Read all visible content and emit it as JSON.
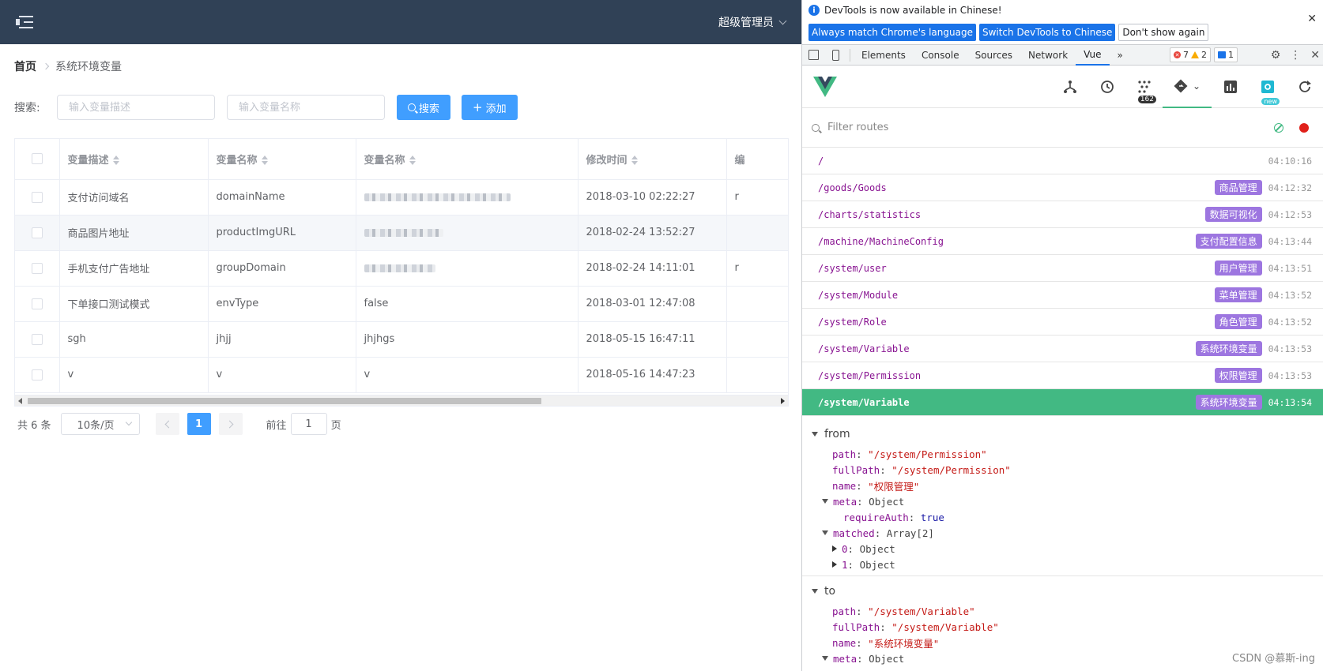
{
  "app": {
    "user_name": "超级管理员",
    "breadcrumb": {
      "home": "首页",
      "current": "系统环境变量"
    },
    "search": {
      "label": "搜索:",
      "desc_placeholder": "输入变量描述",
      "name_placeholder": "输入变量名称",
      "search_btn": "搜索",
      "add_btn": "添加"
    },
    "table": {
      "headers": [
        "变量描述",
        "变量名称",
        "变量名称",
        "修改时间"
      ],
      "rows": [
        {
          "desc": "支付访问域名",
          "name": "domainName",
          "value": "",
          "time": "2018-03-10 02:22:27",
          "more": "r"
        },
        {
          "desc": "商品图片地址",
          "name": "productImgURL",
          "value": "",
          "time": "2018-02-24 13:52:27",
          "more": ""
        },
        {
          "desc": "手机支付广告地址",
          "name": "groupDomain",
          "value": "",
          "time": "2018-02-24 14:11:01",
          "more": "r"
        },
        {
          "desc": "下单接口测试模式",
          "name": "envType",
          "value": "false",
          "time": "2018-03-01 12:47:08",
          "more": ""
        },
        {
          "desc": "sgh",
          "name": "jhjj",
          "value": "jhjhgs",
          "time": "2018-05-15 16:47:11",
          "more": ""
        },
        {
          "desc": "v",
          "name": "v",
          "value": "v",
          "time": "2018-05-16 14:47:23",
          "more": ""
        }
      ]
    },
    "pager": {
      "total": "共 6 条",
      "page_size": "10条/页",
      "current": "1",
      "goto_label": "前往",
      "goto_value": "1",
      "page_suffix": "页"
    }
  },
  "devtools": {
    "info_message": "DevTools is now available in Chinese!",
    "btn_match": "Always match Chrome's language",
    "btn_switch": "Switch DevTools to Chinese",
    "btn_dismiss": "Don't show again",
    "tabs": [
      "Elements",
      "Console",
      "Sources",
      "Network",
      "Vue"
    ],
    "errors": "7",
    "warnings": "2",
    "messages": "1",
    "component_count": "162",
    "new_badge": "new",
    "filter_placeholder": "Filter routes",
    "routes": [
      {
        "path": "/",
        "tag": "",
        "time": "04:10:16"
      },
      {
        "path": "/goods/Goods",
        "tag": "商品管理",
        "time": "04:12:32"
      },
      {
        "path": "/charts/statistics",
        "tag": "数据可视化",
        "time": "04:12:53"
      },
      {
        "path": "/machine/MachineConfig",
        "tag": "支付配置信息",
        "time": "04:13:44"
      },
      {
        "path": "/system/user",
        "tag": "用户管理",
        "time": "04:13:51"
      },
      {
        "path": "/system/Module",
        "tag": "菜单管理",
        "time": "04:13:52"
      },
      {
        "path": "/system/Role",
        "tag": "角色管理",
        "time": "04:13:52"
      },
      {
        "path": "/system/Variable",
        "tag": "系统环境变量",
        "time": "04:13:53"
      },
      {
        "path": "/system/Permission",
        "tag": "权限管理",
        "time": "04:13:53"
      },
      {
        "path": "/system/Variable",
        "tag": "系统环境变量",
        "time": "04:13:54"
      }
    ],
    "from": {
      "title": "from",
      "path": "\"/system/Permission\"",
      "fullPath": "\"/system/Permission\"",
      "name": "\"权限管理\"",
      "meta": "Object",
      "requireAuth": "true",
      "matched": "Array[2]",
      "m0": "Object",
      "m1": "Object"
    },
    "to": {
      "title": "to",
      "path": "\"/system/Variable\"",
      "fullPath": "\"/system/Variable\"",
      "name": "\"系统环境变量\"",
      "meta": "Object"
    },
    "watermark": "CSDN @慕斯-ing"
  }
}
